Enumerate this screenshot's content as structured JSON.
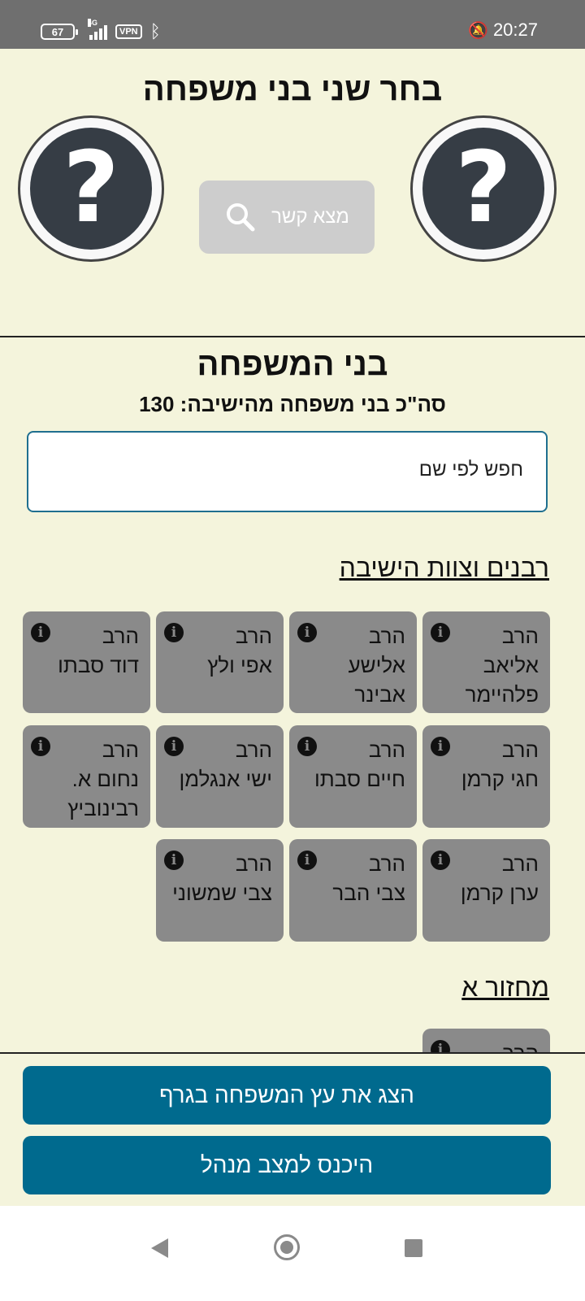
{
  "status_bar": {
    "battery": "67",
    "network": "4G",
    "vpn": "VPN",
    "time": "20:27",
    "icons": [
      "battery-icon",
      "signal-icon",
      "vpn-icon",
      "bluetooth-icon",
      "bell-off-icon"
    ]
  },
  "header": {
    "title": "בחר שני בני משפחה",
    "find_button": "מצא קשר",
    "question_mark": "?"
  },
  "family": {
    "title": "בני המשפחה",
    "count_label": "סה\"כ בני משפחה מהישיבה: 130",
    "search_placeholder": "חפש לפי שם"
  },
  "groups": [
    {
      "title": "רבנים וצוות הישיבה",
      "members": [
        {
          "title": "הרב",
          "name": "אליאב פלהיימר"
        },
        {
          "title": "הרב",
          "name": "אלישע אבינר"
        },
        {
          "title": "הרב",
          "name": "אפי ולץ"
        },
        {
          "title": "הרב",
          "name": "דוד סבתו"
        },
        {
          "title": "הרב",
          "name": "חגי קרמן"
        },
        {
          "title": "הרב",
          "name": "חיים סבתו"
        },
        {
          "title": "הרב",
          "name": "ישי אנגלמן"
        },
        {
          "title": "הרב",
          "name": "נחום א. רבינוביץ"
        },
        {
          "title": "הרב",
          "name": "ערן קרמן"
        },
        {
          "title": "הרב",
          "name": "צבי הבר"
        },
        {
          "title": "הרב",
          "name": "צבי שמשוני"
        }
      ]
    },
    {
      "title": "מחזור א",
      "members": [
        {
          "title": "הרב",
          "name": ""
        }
      ]
    }
  ],
  "actions": {
    "show_tree": "הצג את עץ המשפחה בגרף",
    "admin_mode": "היכנס למצב מנהל"
  },
  "info_glyph": "i",
  "colors": {
    "background": "#f4f4dc",
    "card": "#8a8a8a",
    "primary_button": "#006a8e",
    "status_bar": "#6f6f6f"
  }
}
